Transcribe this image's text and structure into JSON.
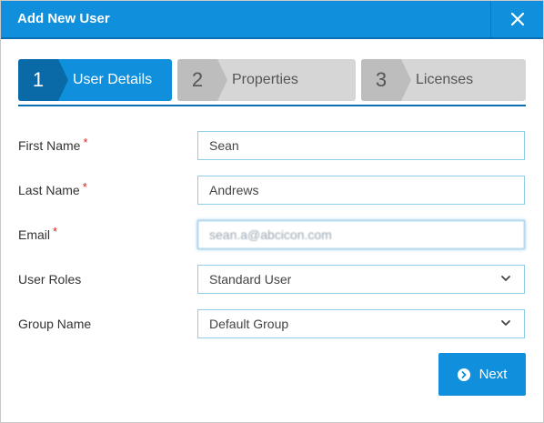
{
  "dialog": {
    "title": "Add New User",
    "close_icon": "close-icon"
  },
  "steps": [
    {
      "number": "1",
      "label": "User Details",
      "active": true
    },
    {
      "number": "2",
      "label": "Properties",
      "active": false
    },
    {
      "number": "3",
      "label": "Licenses",
      "active": false
    }
  ],
  "form": {
    "first_name": {
      "label": "First Name",
      "required_mark": "*",
      "value": "Sean"
    },
    "last_name": {
      "label": "Last Name",
      "required_mark": "*",
      "value": "Andrews"
    },
    "email": {
      "label": "Email",
      "required_mark": "*",
      "value": "sean.a@abcicon.com"
    },
    "user_roles": {
      "label": "User Roles",
      "selected": "Standard User"
    },
    "group_name": {
      "label": "Group Name",
      "selected": "Default Group"
    }
  },
  "actions": {
    "next_label": "Next",
    "next_icon": "arrow-circle-right-icon"
  },
  "colors": {
    "primary": "#0f8fdc",
    "primary_dark": "#0a6aa8",
    "inactive_step": "#d6d6d6",
    "required": "#d9251d",
    "field_border": "#8fcde6"
  }
}
